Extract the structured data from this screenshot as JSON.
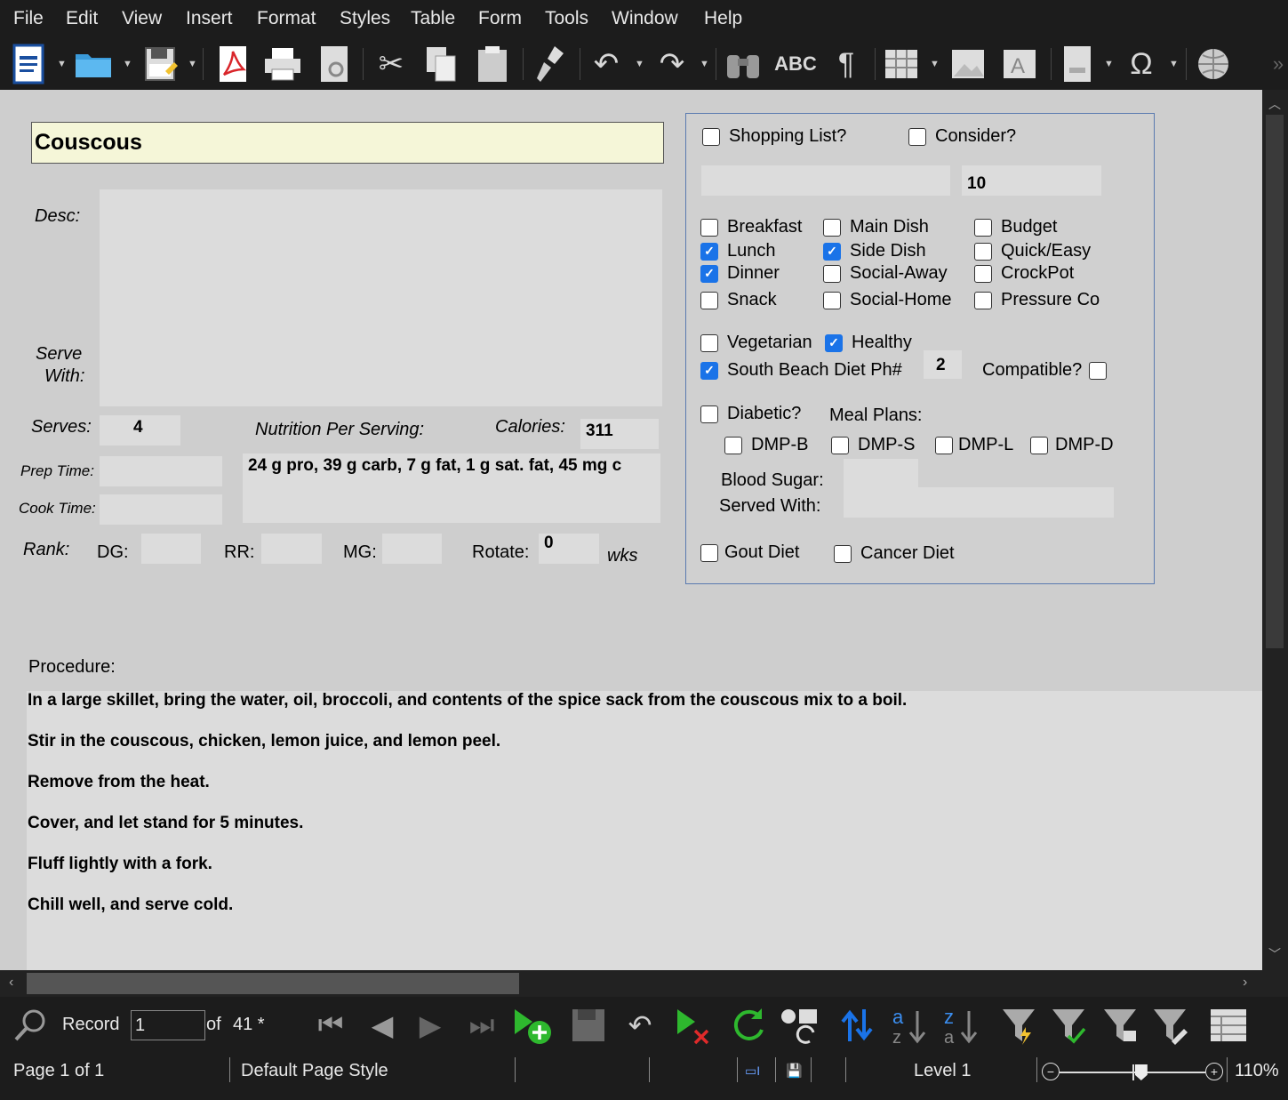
{
  "menu": [
    "File",
    "Edit",
    "View",
    "Insert",
    "Format",
    "Styles",
    "Table",
    "Form",
    "Tools",
    "Window",
    "Help"
  ],
  "record": {
    "title": "Couscous",
    "desc_label": "Desc:",
    "serve_with_label_1": "Serve",
    "serve_with_label_2": "With:",
    "serves_label": "Serves:",
    "serves": "4",
    "nutrition_label": "Nutrition Per Serving:",
    "calories_label": "Calories:",
    "calories": "311",
    "nutrition": "24 g pro, 39 g carb, 7 g fat, 1 g sat. fat, 45 mg c",
    "prep_label": "Prep Time:",
    "cook_label": "Cook Time:",
    "rank_label": "Rank:",
    "dg_label": "DG:",
    "rr_label": "RR:",
    "mg_label": "MG:",
    "rotate_label": "Rotate:",
    "rotate": "0",
    "wks_label": "wks",
    "procedure_label": "Procedure:",
    "procedure": [
      "In a large skillet, bring the water, oil, broccoli, and contents of the spice sack from the couscous mix to a boil.",
      "Stir in the couscous, chicken, lemon juice, and lemon peel.",
      "Remove from the heat.",
      "Cover, and let stand for 5 minutes.",
      "Fluff lightly with a fork.",
      "Chill well, and serve cold."
    ]
  },
  "panel": {
    "shopping_list": {
      "label": "Shopping List?",
      "checked": false
    },
    "consider": {
      "label": "Consider?",
      "checked": false
    },
    "count_value": "10",
    "categories": [
      {
        "label": "Breakfast",
        "checked": false
      },
      {
        "label": "Lunch",
        "checked": true
      },
      {
        "label": "Dinner",
        "checked": true
      },
      {
        "label": "Snack",
        "checked": false
      },
      {
        "label": "Main Dish",
        "checked": false
      },
      {
        "label": "Side Dish",
        "checked": true
      },
      {
        "label": "Social-Away",
        "checked": false
      },
      {
        "label": "Social-Home",
        "checked": false
      },
      {
        "label": "Budget",
        "checked": false
      },
      {
        "label": "Quick/Easy",
        "checked": false
      },
      {
        "label": "CrockPot",
        "checked": false
      },
      {
        "label": "Pressure Co",
        "checked": false
      }
    ],
    "vegetarian": {
      "label": "Vegetarian",
      "checked": false
    },
    "healthy": {
      "label": "Healthy",
      "checked": true
    },
    "south_beach": {
      "label": "South Beach Diet Ph#",
      "checked": true
    },
    "phase": "2",
    "compatible": {
      "label": "Compatible?",
      "checked": false
    },
    "diabetic": {
      "label": "Diabetic?",
      "checked": false
    },
    "meal_plans_label": "Meal Plans:",
    "dmp": [
      {
        "label": "DMP-B",
        "checked": false
      },
      {
        "label": "DMP-S",
        "checked": false
      },
      {
        "label": "DMP-L",
        "checked": false
      },
      {
        "label": "DMP-D",
        "checked": false
      }
    ],
    "blood_sugar_label": "Blood Sugar:",
    "served_with_label": "Served With:",
    "gout": {
      "label": "Gout Diet",
      "checked": false
    },
    "cancer": {
      "label": "Cancer Diet",
      "checked": false
    }
  },
  "navigation": {
    "record_label": "Record",
    "record_number": "1",
    "of_label": "of",
    "total": "41 *"
  },
  "status": {
    "page": "Page 1 of 1",
    "page_style": "Default Page Style",
    "level": "Level 1",
    "zoom": "110%",
    "zoom_fraction": 0.56
  },
  "colors": {
    "accent": "#1a73e8",
    "title_bg": "#f5f6d8",
    "panel_border": "#5a7ab0"
  }
}
